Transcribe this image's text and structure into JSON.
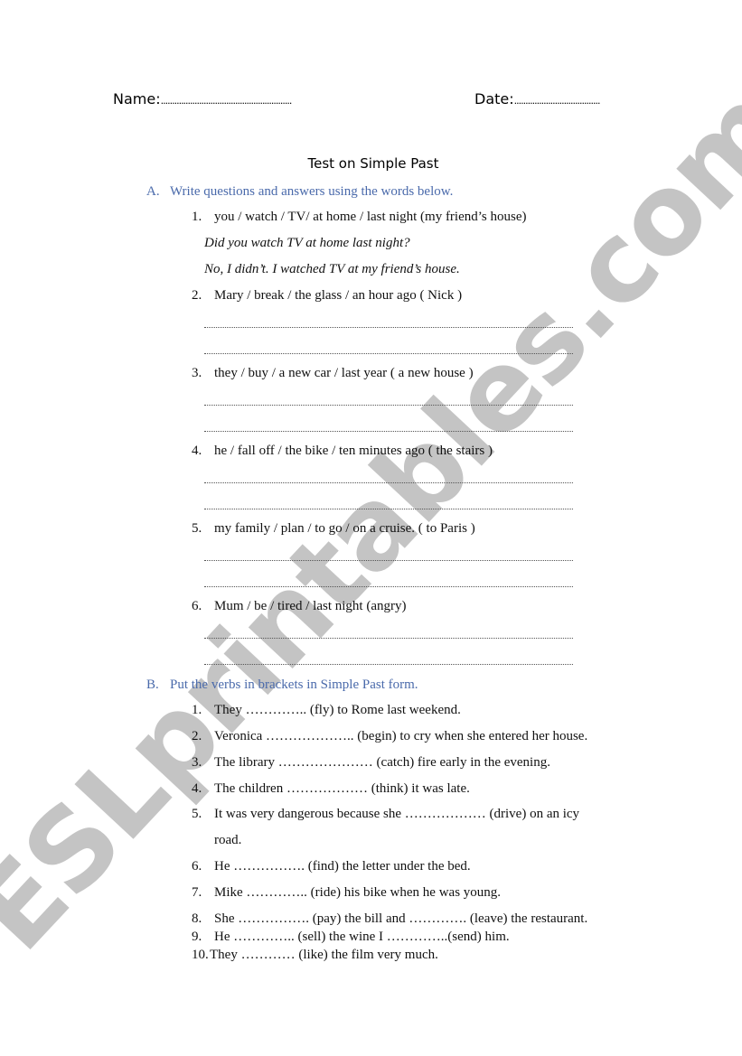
{
  "header": {
    "name_label": "Name:",
    "name_fill": "..........................................................",
    "date_label": "Date:",
    "date_fill": "......................................"
  },
  "title": "Test on Simple Past",
  "section_a": {
    "letter": "A.",
    "instruction": "Write questions and answers using the words below.",
    "items": [
      {
        "num": "1.",
        "prompt": "you / watch / TV/ at home / last night (my friend’s house)"
      },
      {
        "num": "2.",
        "prompt": "Mary / break / the glass / an hour ago ( Nick )"
      },
      {
        "num": "3.",
        "prompt": "they / buy / a new car / last year ( a new house )"
      },
      {
        "num": "4.",
        "prompt": "he / fall off / the bike / ten minutes ago ( the stairs )"
      },
      {
        "num": "5.",
        "prompt": "my family / plan / to go / on a cruise. ( to Paris )"
      },
      {
        "num": "6.",
        "prompt": "Mum / be / tired / last night (angry)"
      }
    ],
    "example_question": "Did you watch TV at home last night?",
    "example_answer": "No, I didn’t. I watched TV at my friend’s house."
  },
  "section_b": {
    "letter": "B.",
    "instruction": "Put the verbs in brackets in Simple Past form.",
    "items": [
      {
        "num": "1.",
        "text": "They ………….. (fly) to Rome last weekend."
      },
      {
        "num": "2.",
        "text": "Veronica ……………….. (begin) to cry when she entered her house."
      },
      {
        "num": "3.",
        "text": "The library ………………… (catch) fire early in the evening."
      },
      {
        "num": "4.",
        "text": "The children ……………… (think) it was late."
      },
      {
        "num": "5.",
        "text": "It was very dangerous because she ……………… (drive) on an icy",
        "continuation": "road."
      },
      {
        "num": "6.",
        "text": "He ……………. (find) the letter under the bed."
      },
      {
        "num": "7.",
        "text": "Mike ………….. (ride) his bike when he was young."
      },
      {
        "num": "8.",
        "text": "She ……………. (pay) the bill and …………. (leave) the restaurant."
      },
      {
        "num": "9.",
        "text": "He ………….. (sell) the wine I …………..(send) him."
      },
      {
        "num": "10.",
        "text": "They ………… (like) the film very much."
      }
    ]
  },
  "watermark": "ESLprintables.com",
  "colors": {
    "section_heading": "#4a6aab",
    "watermark": "#c4c4c4"
  }
}
